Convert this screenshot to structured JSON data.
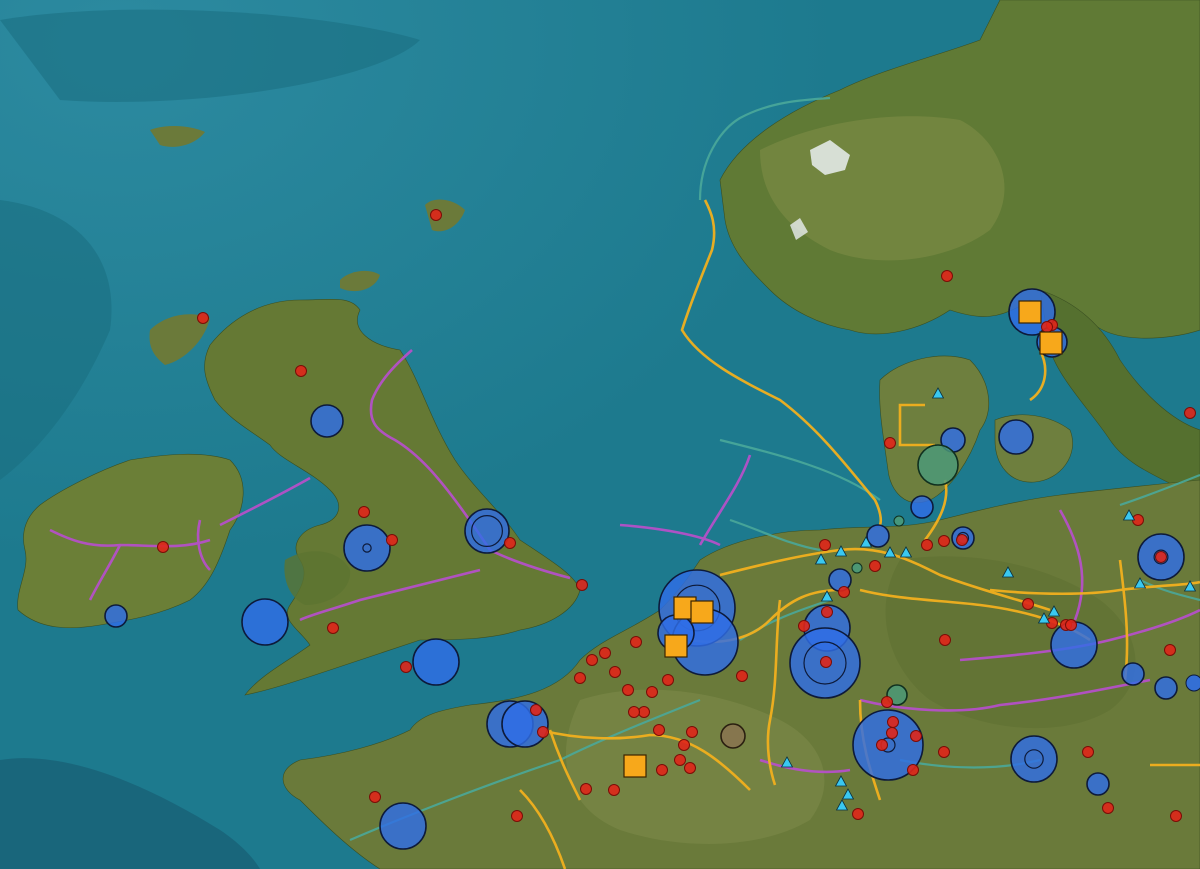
{
  "map": {
    "colors": {
      "sea": "#1f7f91",
      "sea_deep": "#17677a",
      "land": "#6d7d3c",
      "land_dark": "#4f6a2c",
      "land_light": "#8a8a4c",
      "snow": "#e9eef0"
    },
    "layers": {
      "gas_pipelines": {
        "color": "#f2b01e",
        "label": ""
      },
      "power_lines_hvdc": {
        "color": "#b550c8",
        "label": ""
      },
      "other_links": {
        "color": "#4aa89a",
        "label": ""
      }
    },
    "marker_styles": {
      "large_plant": {
        "fill": "#2f6ee6",
        "stroke": "#0d1a3a"
      },
      "small_plant": {
        "fill": "#e0261a",
        "stroke": "#7a0d07"
      },
      "lng_terminal": {
        "fill": "#f7a81b",
        "stroke": "#3a2300",
        "icon": "square"
      },
      "storage": {
        "fill": "#4a9a7a",
        "stroke": "#10301f"
      },
      "other_site": {
        "fill": "#8a7350",
        "stroke": "#2a1f10"
      },
      "station": {
        "fill": "#3ac8f0",
        "stroke": "#0a3040",
        "icon": "triangle"
      }
    },
    "counts": {
      "large_plants": 27,
      "small_plants": 78,
      "lng_terminals": 6,
      "stations": 17
    }
  }
}
